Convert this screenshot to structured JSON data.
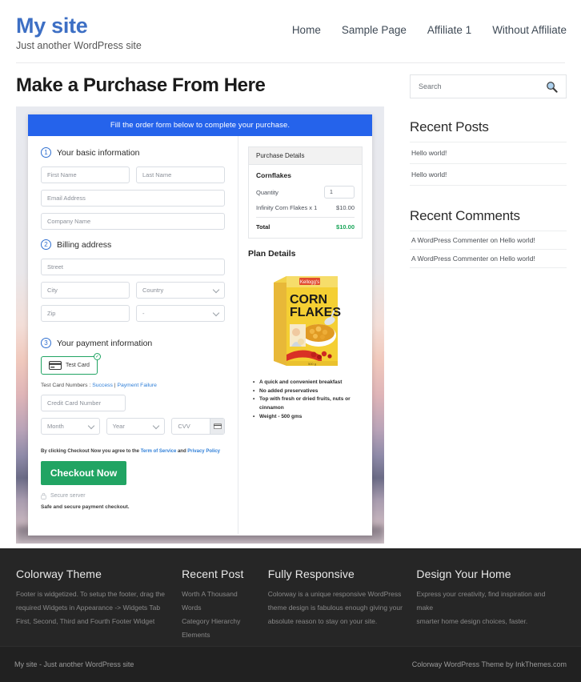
{
  "header": {
    "site_title": "My site",
    "tagline": "Just another WordPress site",
    "nav": [
      {
        "label": "Home"
      },
      {
        "label": "Sample Page"
      },
      {
        "label": "Affiliate 1"
      },
      {
        "label": "Without Affiliate"
      }
    ]
  },
  "main": {
    "page_title": "Make a Purchase From Here",
    "order_banner": "Fill the order form below to complete your purchase.",
    "steps": {
      "step1_num": "1",
      "step1_label": "Your basic information",
      "step2_num": "2",
      "step2_label": "Billing address",
      "step3_num": "3",
      "step3_label": "Your payment information"
    },
    "fields": {
      "first_name": "First Name",
      "last_name": "Last Name",
      "email": "Email Address",
      "company": "Company Name",
      "street": "Street",
      "city": "City",
      "country": "Country",
      "zip": "Zip",
      "state": "-",
      "card_number": "Credit Card Number",
      "month": "Month",
      "year": "Year",
      "cvv": "CVV"
    },
    "payment": {
      "test_card_label": "Test Card",
      "test_numbers_prefix": "Test Card Numbers : ",
      "success_link": "Success",
      "separator": " | ",
      "failure_link": "Payment Failure",
      "terms_prefix": "By clicking Checkout Now you agree to the ",
      "terms_link": "Term of Service",
      "terms_and": " and ",
      "privacy_link": "Privacy Policy",
      "checkout_button": "Checkout Now",
      "secure_server": "Secure server",
      "safe_note": "Safe and secure payment checkout."
    },
    "purchase_details": {
      "heading": "Purchase Details",
      "product": "Cornflakes",
      "quantity_label": "Quantity",
      "quantity_value": "1",
      "line_item_label": "Infinity Corn Flakes x 1",
      "line_item_price": "$10.00",
      "total_label": "Total",
      "total_price": "$10.00"
    },
    "plan": {
      "title": "Plan Details",
      "product_box_brand": "CORN",
      "product_box_brand2": "FLAKES",
      "bullets": [
        "A quick and convenient breakfast",
        "No added preservatives",
        "Top with fresh or dried fruits, nuts or cinnamon",
        "Weight - 500 gms"
      ]
    }
  },
  "sidebar": {
    "search_placeholder": "Search",
    "recent_posts_title": "Recent Posts",
    "recent_posts": [
      {
        "label": "Hello world!"
      },
      {
        "label": "Hello world!"
      }
    ],
    "recent_comments_title": "Recent Comments",
    "recent_comments": [
      {
        "label": "A WordPress Commenter on Hello world!"
      },
      {
        "label": "A WordPress Commenter on Hello world!"
      }
    ]
  },
  "footer": {
    "columns": [
      {
        "title": "Colorway Theme",
        "lines": [
          "Footer is widgetized. To setup the footer, drag the",
          "required Widgets in Appearance -> Widgets Tab",
          "First, Second, Third and Fourth Footer Widget"
        ]
      },
      {
        "title": "Recent Post",
        "lines": [
          "Worth A Thousand Words",
          "Category Hierarchy",
          "Elements"
        ]
      },
      {
        "title": "Fully Responsive",
        "lines": [
          "Colorway is a unique responsive WordPress",
          "theme design is fabulous enough giving your",
          "absolute reason to stay on your site."
        ]
      },
      {
        "title": "Design Your Home",
        "lines": [
          "Express your creativity, find inspiration and make",
          "smarter home design choices, faster."
        ]
      }
    ],
    "bottom_left": "My site - Just another WordPress site",
    "bottom_right": "Colorway WordPress Theme by InkThemes.com"
  },
  "colors": {
    "brand_blue": "#3d6fc4",
    "banner_blue": "#2563eb",
    "success_green": "#21a463",
    "total_green": "#18a558",
    "footer_dark": "#262626",
    "footer_bottom": "#212121"
  }
}
